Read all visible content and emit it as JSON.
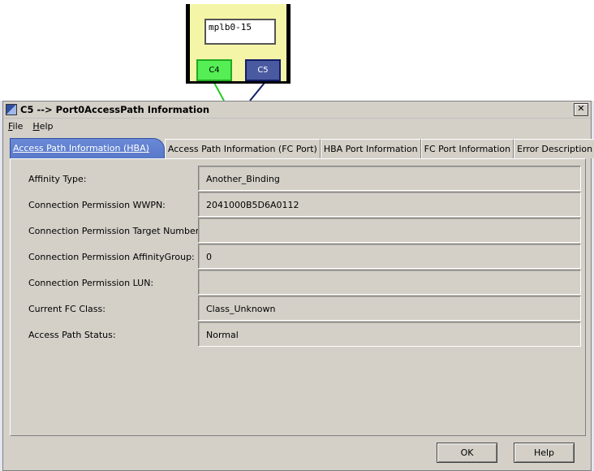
{
  "canvas": {
    "node_label": "mplb0-15",
    "port_c4": "C4",
    "port_c5": "C5"
  },
  "dialog": {
    "title": "C5 --> Port0AccessPath Information",
    "close_glyph": "✕",
    "menu": [
      {
        "label": "File",
        "mnemonic": "F"
      },
      {
        "label": "Help",
        "mnemonic": "H"
      }
    ],
    "tabs": [
      "Access Path Information (HBA)",
      "Access Path Information (FC Port)",
      "HBA Port Information",
      "FC Port Information",
      "Error Description"
    ],
    "fields": [
      {
        "label": "Affinity Type:",
        "value": "Another_Binding"
      },
      {
        "label": "Connection Permission WWPN:",
        "value": "2041000B5D6A0112"
      },
      {
        "label": "Connection Permission Target Number:",
        "value": ""
      },
      {
        "label": "Connection Permission AffinityGroup:",
        "value": "0"
      },
      {
        "label": "Connection Permission LUN:",
        "value": ""
      },
      {
        "label": "Current FC Class:",
        "value": "Class_Unknown"
      },
      {
        "label": "Access Path Status:",
        "value": "Normal"
      }
    ],
    "ok_label": "OK",
    "help_label": "Help"
  },
  "colors": {
    "active_tab": "#5878c8",
    "port_c4": "#55ee55",
    "port_c5": "#4a5aa0",
    "node_fill": "#f5f5a8"
  }
}
